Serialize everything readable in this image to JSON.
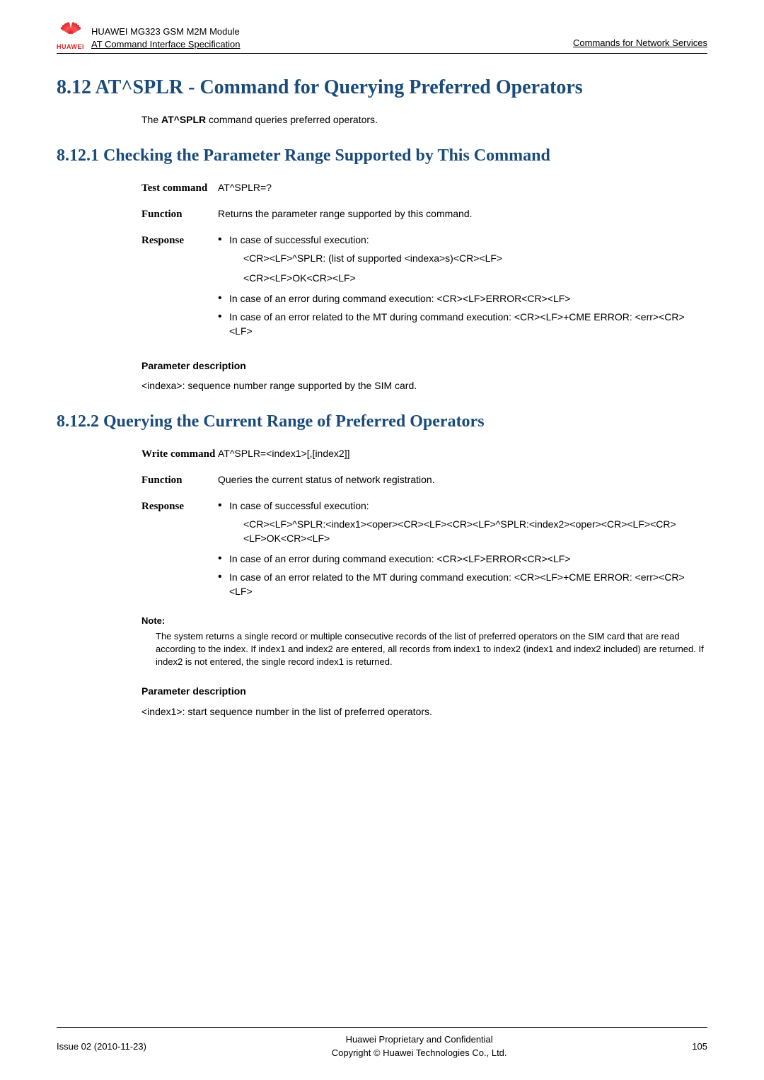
{
  "header": {
    "product_line1": "HUAWEI MG323 GSM M2M Module",
    "product_line2": "AT Command Interface Specification",
    "right": "Commands for Network Services",
    "brand": "HUAWEI"
  },
  "section": {
    "num": "8.12",
    "title": "AT^SPLR - Command for Querying Preferred Operators"
  },
  "intro": {
    "pre": "The ",
    "cmd": "AT^SPLR",
    "post": " command queries preferred operators."
  },
  "sub1": {
    "num": "8.12.1",
    "title": "Checking the Parameter Range Supported by This Command",
    "rows": {
      "test_label": "Test command",
      "test_value": "AT^SPLR=?",
      "func_label": "Function",
      "func_value": "Returns the parameter range supported by this command.",
      "resp_label": "Response",
      "b1": "In case of successful execution:",
      "b1_sub1": "<CR><LF>^SPLR: (list of supported <indexa>s)<CR><LF>",
      "b1_sub2": "<CR><LF>OK<CR><LF>",
      "b2": "In case of an error during command execution: <CR><LF>ERROR<CR><LF>",
      "b3": "In case of an error related to the MT during command execution: <CR><LF>+CME ERROR: <err><CR><LF>"
    },
    "param_head": "Parameter description",
    "param_line": "<indexa>: sequence number range supported by the SIM card."
  },
  "sub2": {
    "num": "8.12.2",
    "title": "Querying the Current Range of Preferred Operators",
    "rows": {
      "write_label": "Write command",
      "write_value": "AT^SPLR=<index1>[,[index2]]",
      "func_label": "Function",
      "func_value": "Queries the current status of network registration.",
      "resp_label": "Response",
      "b1": "In case of successful execution:",
      "b1_sub1": "<CR><LF>^SPLR:<index1><oper><CR><LF><CR><LF>^SPLR:<index2><oper><CR><LF><CR><LF>OK<CR><LF>",
      "b2": "In case of an error during command execution: <CR><LF>ERROR<CR><LF>",
      "b3": "In case of an error related to the MT during command execution: <CR><LF>+CME ERROR: <err><CR><LF>"
    },
    "note_label": "Note:",
    "note_body": "The system returns a single record or multiple consecutive records of the list of preferred operators on the SIM card that are read according to the index. If index1 and index2 are entered, all records from index1 to index2 (index1 and index2 included) are returned. If index2 is not entered, the single record index1 is returned.",
    "param_head": "Parameter description",
    "param_line": "<index1>: start sequence number in the list of preferred operators."
  },
  "footer": {
    "left": "Issue 02 (2010-11-23)",
    "center1": "Huawei Proprietary and Confidential",
    "center2": "Copyright © Huawei Technologies Co., Ltd.",
    "right": "105"
  }
}
